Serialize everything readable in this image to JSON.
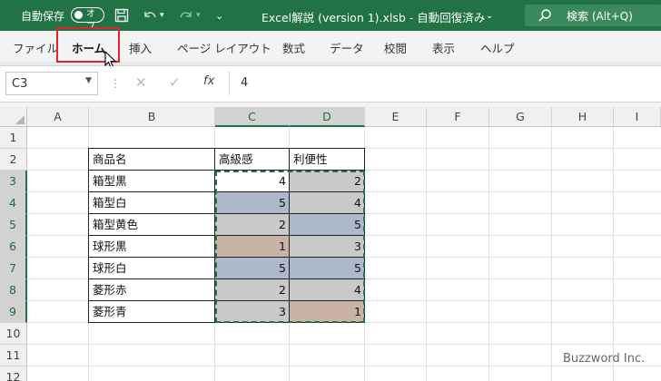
{
  "titlebar": {
    "autosave_label": "自動保存",
    "autosave_state": "オフ",
    "title": "Excel解説 (version 1).xlsb  -  自動回復済み",
    "search_text": "検索 (Alt+Q)",
    "bg_color": "#217346"
  },
  "ribbon": {
    "tabs": [
      "ファイル",
      "ホーム",
      "挿入",
      "ページ レイアウト",
      "数式",
      "データ",
      "校閲",
      "表示",
      "ヘルプ"
    ],
    "active_tab": "ホーム",
    "highlight_color": "#e0242e"
  },
  "formula_bar": {
    "name_box": "C3",
    "fx_label": "fx",
    "value": "4"
  },
  "sheet": {
    "columns": [
      "A",
      "B",
      "C",
      "D",
      "E",
      "F",
      "G",
      "H",
      "I"
    ],
    "rows": [
      "1",
      "2",
      "3",
      "4",
      "5",
      "6",
      "7",
      "8",
      "9",
      "10",
      "11",
      "12"
    ],
    "headers": {
      "b": "商品名",
      "c": "高級感",
      "d": "利便性"
    },
    "table": [
      {
        "name": "箱型黒",
        "c": "4",
        "d": "2",
        "c_fill": "#ffffff",
        "d_fill": "#c9c9c9"
      },
      {
        "name": "箱型白",
        "c": "5",
        "d": "4",
        "c_fill": "#adb9ca",
        "d_fill": "#c9c9c9"
      },
      {
        "name": "箱型黄色",
        "c": "2",
        "d": "5",
        "c_fill": "#c9c9c9",
        "d_fill": "#adb9ca"
      },
      {
        "name": "球形黒",
        "c": "1",
        "d": "3",
        "c_fill": "#c9b2a6",
        "d_fill": "#c9c9c9"
      },
      {
        "name": "球形白",
        "c": "5",
        "d": "5",
        "c_fill": "#adb9ca",
        "d_fill": "#adb9ca"
      },
      {
        "name": "菱形赤",
        "c": "2",
        "d": "4",
        "c_fill": "#c9c9c9",
        "d_fill": "#c9c9c9"
      },
      {
        "name": "菱形青",
        "c": "3",
        "d": "1",
        "c_fill": "#c9c9c9",
        "d_fill": "#c9b2a6"
      }
    ],
    "selected_columns": [
      "C",
      "D"
    ],
    "selected_rows": [
      "3",
      "4",
      "5",
      "6",
      "7",
      "8",
      "9"
    ]
  },
  "watermark": "Buzzword Inc."
}
